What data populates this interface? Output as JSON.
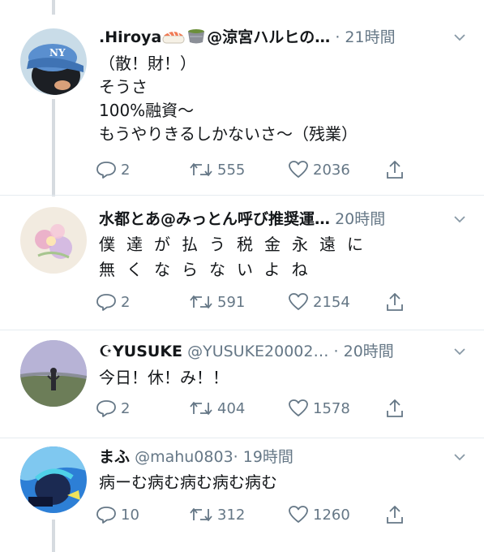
{
  "tweets": [
    {
      "name": ".Hiroya",
      "handle": "@涼宮ハルヒの…",
      "time": "· 21時間",
      "body": "（散！財！）\nそうさ\n100%融資〜\nもうやりきるしかないさ〜（残業）",
      "replies": "2",
      "retweets": "555",
      "likes": "2036",
      "name_icons": [
        "sushi-icon",
        "tea-icon"
      ]
    },
    {
      "name": "水都とあ@みっとん呼び推奨運…",
      "handle": "",
      "time": "20時間",
      "body": "僕達が払う税金永遠に\n無くならないよね",
      "replies": "2",
      "retweets": "591",
      "likes": "2154"
    },
    {
      "name": "☪YUSUKE",
      "handle": "@YUSUKE20002…",
      "time": "· 20時間",
      "body": "今日！休！み！！",
      "replies": "2",
      "retweets": "404",
      "likes": "1578"
    },
    {
      "name": "まふ",
      "handle": "@mahu0803",
      "time": "· 19時間",
      "body": "病ーむ病む病む病む病む",
      "replies": "10",
      "retweets": "312",
      "likes": "1260"
    }
  ],
  "colors": {
    "text": "#14171a",
    "secondary": "#657786",
    "thread_line": "#d6dbe0",
    "divider": "#e6ecf0"
  }
}
